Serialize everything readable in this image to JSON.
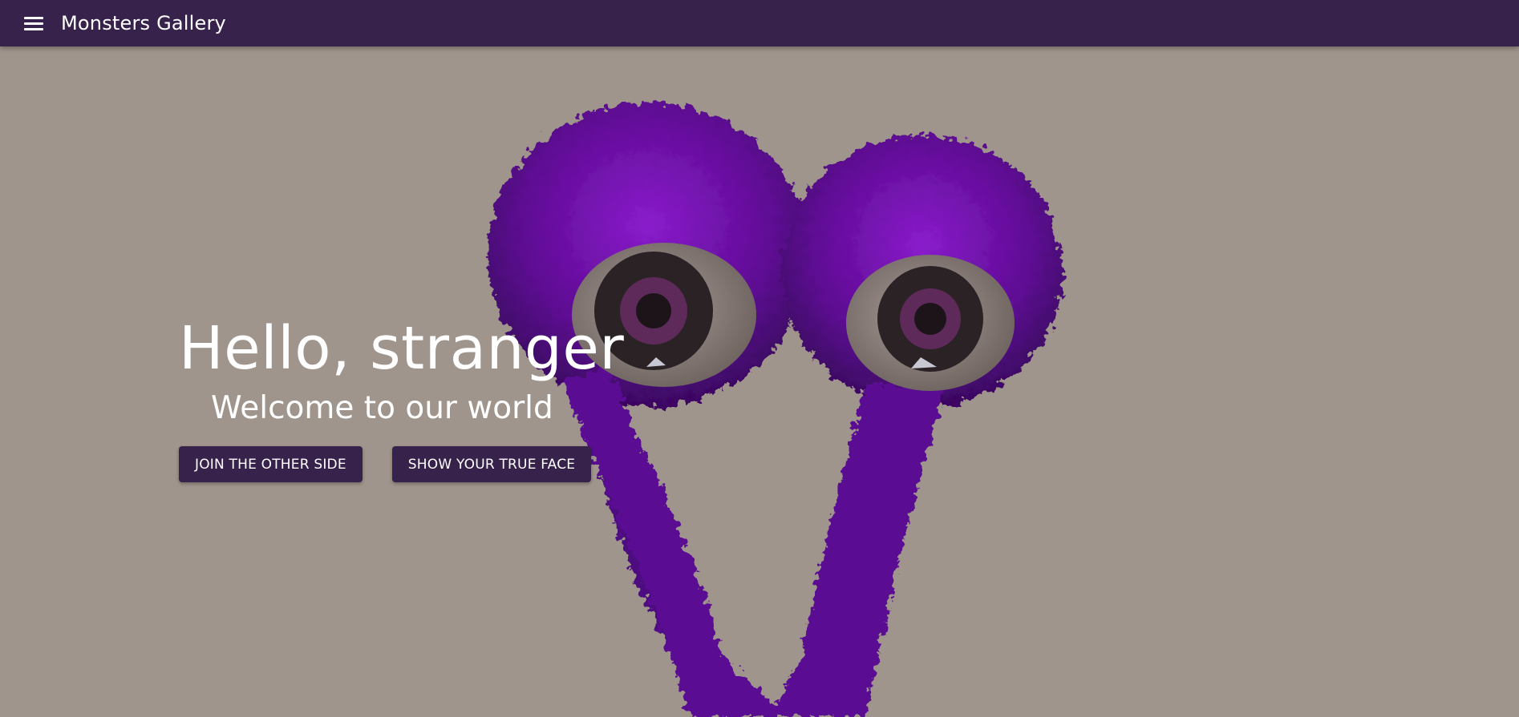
{
  "header": {
    "menu_icon": "menu-icon",
    "title": "Monsters Gallery"
  },
  "hero": {
    "title": "Hello, stranger",
    "subtitle": "Welcome to our world",
    "buttons": [
      {
        "label": "JOIN THE OTHER SIDE"
      },
      {
        "label": "SHOW YOUR TRUE FACE"
      }
    ]
  },
  "colors": {
    "app_bar": "#37224c",
    "background": "#a0958c",
    "button": "#37224c",
    "monster_fur": "#6a0ea0"
  }
}
